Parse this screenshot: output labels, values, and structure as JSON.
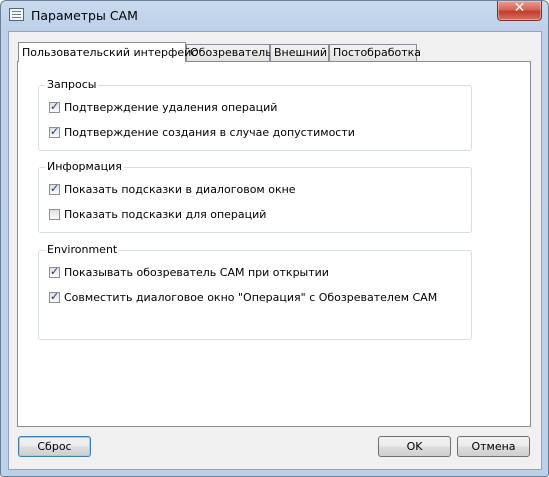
{
  "window": {
    "title": "Параметры CAM",
    "close_glyph": "✕"
  },
  "tabs": [
    {
      "label": "Пользовательский интерфейс",
      "active": true
    },
    {
      "label": "Обозреватель",
      "active": false
    },
    {
      "label": "Внешний",
      "active": false
    },
    {
      "label": "Постобработка",
      "active": false
    }
  ],
  "groups": [
    {
      "title": "Запросы",
      "items": [
        {
          "label": "Подтверждение удаления операций",
          "checked": true
        },
        {
          "label": "Подтверждение создания в случае допустимости",
          "checked": true
        }
      ]
    },
    {
      "title": "Информация",
      "items": [
        {
          "label": "Показать подсказки в диалоговом окне",
          "checked": true
        },
        {
          "label": "Показать подсказки для операций",
          "checked": false
        }
      ]
    },
    {
      "title": "Environment",
      "items": [
        {
          "label": "Показывать обозреватель CAM при открытии",
          "checked": true
        },
        {
          "label": "Совместить диалоговое окно \"Операция\" с Обозревателем CAM",
          "checked": true
        }
      ]
    }
  ],
  "buttons": {
    "reset": "Сброс",
    "ok": "OK",
    "cancel": "Отмена"
  }
}
